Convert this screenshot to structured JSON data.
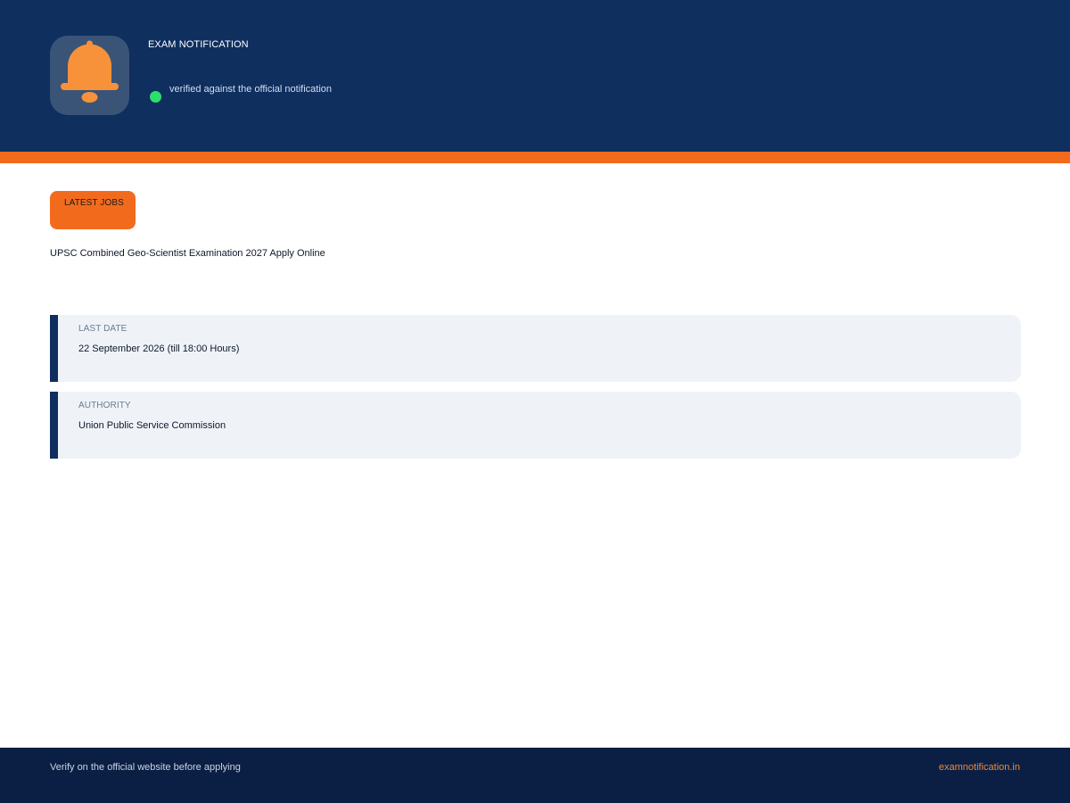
{
  "colors": {
    "header_bg": "#0f2f5f",
    "accent": "#f26b1d",
    "verified_dot": "#2ede6b",
    "card_bg": "#eff3f8",
    "footer_bg": "#0b1f45",
    "footer_link": "#f08a35"
  },
  "header": {
    "logo_icon": "bell-icon",
    "title": "EXAM NOTIFICATION",
    "verified_text": "verified against the official notification"
  },
  "main": {
    "category": "LATEST JOBS",
    "job_title": "UPSC Combined Geo-Scientist Examination 2027 Apply Online",
    "cards": [
      {
        "label": "LAST DATE",
        "value": "22 September 2026 (till 18:00 Hours)"
      },
      {
        "label": "AUTHORITY",
        "value": "Union Public Service Commission"
      }
    ]
  },
  "footer": {
    "note": "Verify on the official website before applying",
    "site": "examnotification.in"
  }
}
